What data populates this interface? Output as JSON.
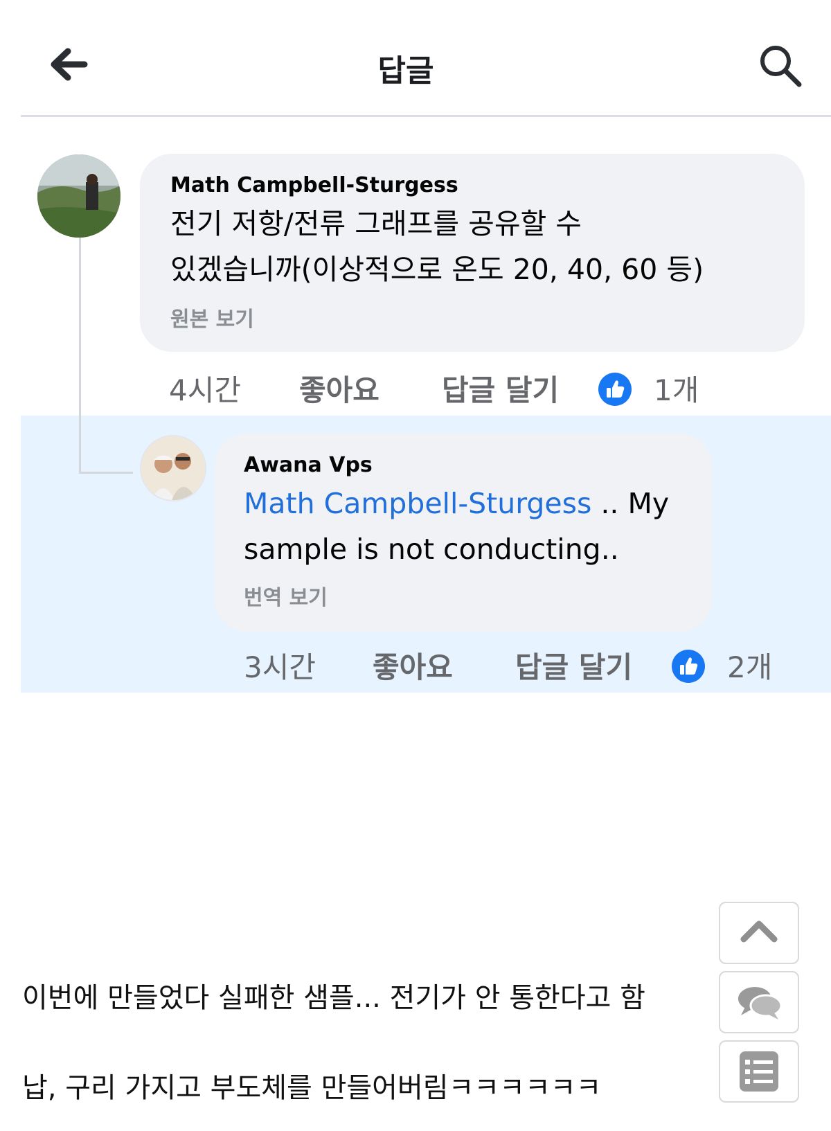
{
  "header": {
    "title": "답글",
    "back_icon": "arrow-left-icon",
    "search_icon": "search-icon"
  },
  "comment": {
    "author": "Math Campbell-Sturgess",
    "text_line1": "전기 저항/전류 그래프를 공유할 수",
    "text_line2": "있겠습니까(이상적으로 온도 20, 40, 60 등)",
    "see_original": "원본 보기",
    "time": "4시간",
    "like_label": "좋아요",
    "reply_label": "답글 달기",
    "like_count": "1개"
  },
  "reply": {
    "author": "Awana Vps",
    "mention": "Math Campbell-Sturgess",
    "text_after_mention": " .. My",
    "text_line2": "sample is not conducting..",
    "see_translation": "번역 보기",
    "time": "3시간",
    "like_label": "좋아요",
    "reply_label": "답글 달기",
    "like_count": "2개"
  },
  "captions": {
    "line1": "이번에 만들었다 실패한 샘플... 전기가 안 통한다고 함",
    "line2": "납, 구리 가지고 부도체를 만들어버림ㅋㅋㅋㅋㅋㅋ"
  },
  "floating_buttons": {
    "up_icon": "chevron-up-icon",
    "comment_icon": "chat-bubbles-icon",
    "list_icon": "list-icon"
  },
  "colors": {
    "accent": "#1877f2",
    "mention": "#216fdb",
    "bubble": "#f0f2f5",
    "highlight": "#e7f3ff"
  }
}
